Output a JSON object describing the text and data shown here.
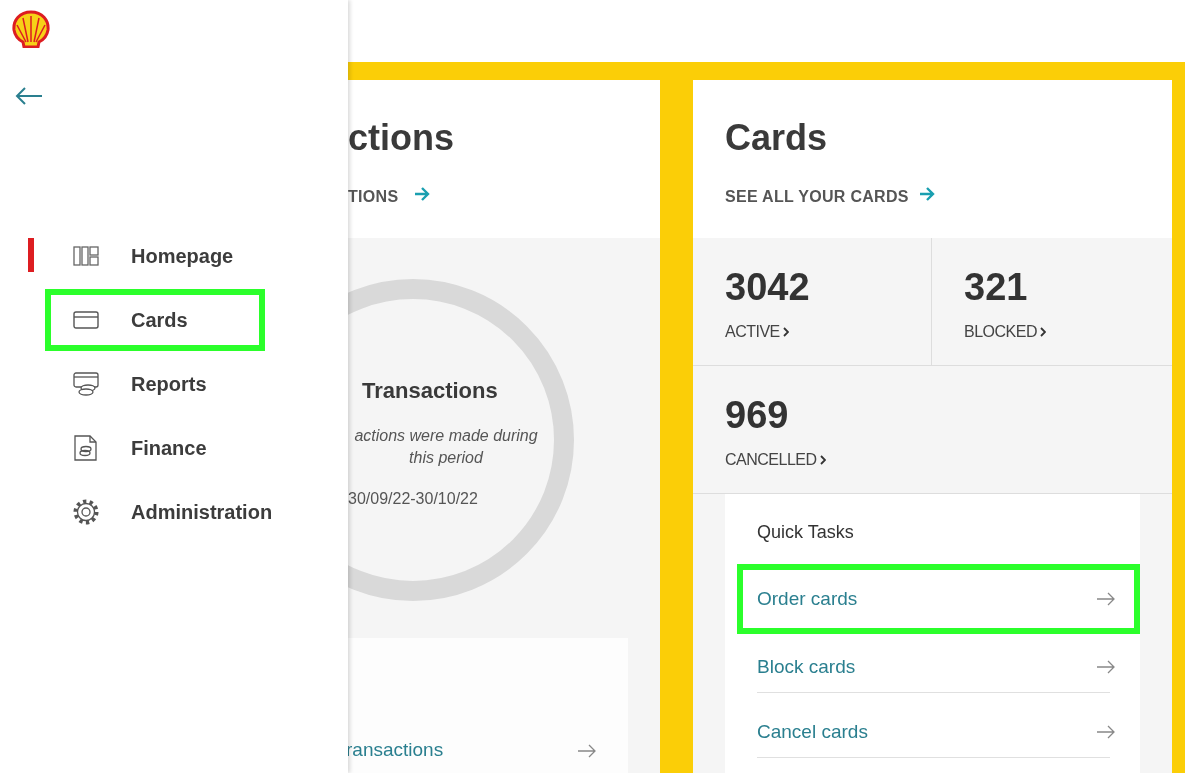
{
  "sidebar": {
    "items": [
      {
        "kind": "grid",
        "label": "Homepage",
        "selected": true,
        "highlighted": false
      },
      {
        "kind": "card",
        "label": "Cards",
        "selected": false,
        "highlighted": true
      },
      {
        "kind": "reports",
        "label": "Reports",
        "selected": false,
        "highlighted": false
      },
      {
        "kind": "finance",
        "label": "Finance",
        "selected": false,
        "highlighted": false
      },
      {
        "kind": "gear",
        "label": "Administration",
        "selected": false,
        "highlighted": false
      }
    ]
  },
  "transactions_panel": {
    "title": "ctions",
    "link": "TIONS",
    "summary_title": "Transactions",
    "summary_text": "actions were made during this period",
    "period": "30/09/22-30/10/22",
    "task": "ransactions"
  },
  "cards_panel": {
    "title": "Cards",
    "link": "SEE ALL YOUR CARDS",
    "stats": [
      {
        "value": "3042",
        "label": "ACTIVE"
      },
      {
        "value": "321",
        "label": "BLOCKED"
      },
      {
        "value": "969",
        "label": "CANCELLED"
      }
    ],
    "quick_tasks": {
      "title": "Quick Tasks",
      "items": [
        {
          "label": "Order cards",
          "highlighted": true
        },
        {
          "label": "Block cards",
          "highlighted": false
        },
        {
          "label": "Cancel cards",
          "highlighted": false
        }
      ]
    }
  }
}
